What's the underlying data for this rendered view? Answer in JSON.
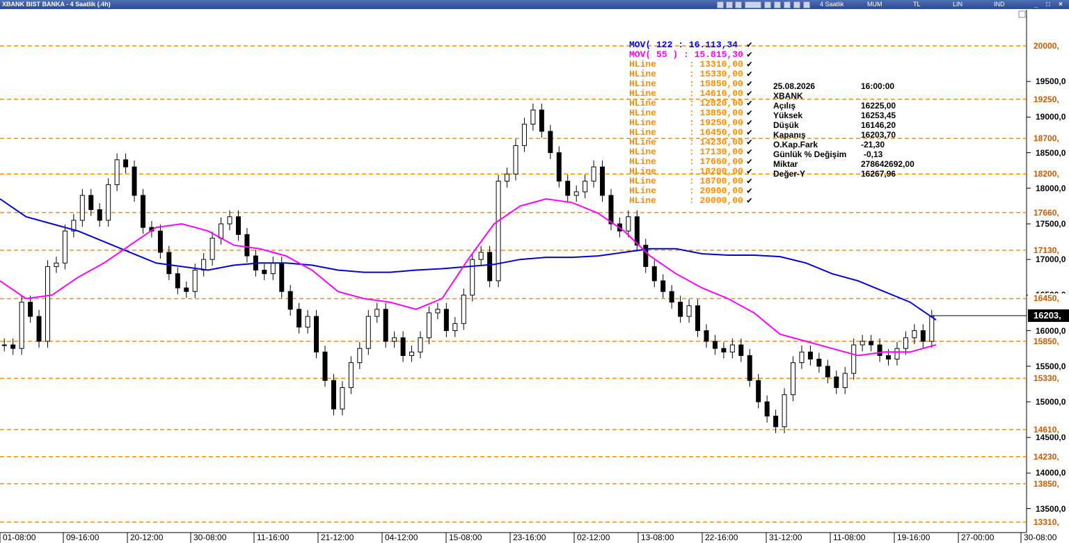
{
  "window": {
    "title": "XBANK BIST BANKA - 4 Saatlik (.4h)",
    "period_label": "4 Saatlik",
    "toolbar_items": [
      "MUM",
      "TL",
      "LIN",
      "IND"
    ],
    "controls": [
      "_",
      "□",
      "×"
    ]
  },
  "legend": {
    "mov122": {
      "label": "MOV( 122 : 16.113,34",
      "color": "#0000ff"
    },
    "mov55": {
      "label": "MOV( 55 ) : 15.815,30",
      "color": "#ff00ff"
    },
    "hlines": [
      {
        "name": "HLine",
        "value": ": 13310,00"
      },
      {
        "name": "HLine",
        "value": ": 15330,00"
      },
      {
        "name": "HLine",
        "value": ": 15850,00"
      },
      {
        "name": "HLine",
        "value": ": 14610,00"
      },
      {
        "name": "HLine",
        "value": ": 12820,00"
      },
      {
        "name": "HLine",
        "value": ": 13850,00"
      },
      {
        "name": "HLine",
        "value": ": 19250,00"
      },
      {
        "name": "HLine",
        "value": ": 16450,00"
      },
      {
        "name": "HLine",
        "value": ": 14230,00"
      },
      {
        "name": "HLine",
        "value": ": 17130,00"
      },
      {
        "name": "HLine",
        "value": ": 17660,00"
      },
      {
        "name": "HLine",
        "value": ": 18200,00"
      },
      {
        "name": "HLine",
        "value": ": 18700,00"
      },
      {
        "name": "HLine",
        "value": ": 20900,00"
      },
      {
        "name": "HLine",
        "value": ": 20000,00"
      }
    ],
    "hline_color": "#ff8c00"
  },
  "info_panel": {
    "date": "25.08.2026",
    "time": "16:00:00",
    "symbol": "XBANK",
    "rows": [
      {
        "label": "Açılış",
        "value": "16225,00"
      },
      {
        "label": "Yüksek",
        "value": "16253,45"
      },
      {
        "label": "Düşük",
        "value": "16146,20"
      },
      {
        "label": "Kapanış",
        "value": "16203,70"
      },
      {
        "label": "O.Kap.Fark",
        "value": "-21,30"
      },
      {
        "label": "Günlük % Değişim",
        "value": "-0,13"
      },
      {
        "label": "Miktar",
        "value": "278642692,00"
      },
      {
        "label": "Değer-Y",
        "value": "16267,96"
      }
    ]
  },
  "chart_data": {
    "type": "candlestick",
    "symbol": "XBANK",
    "ylim": [
      13250,
      20250
    ],
    "y_ticks": [
      13500,
      14000,
      14500,
      15000,
      15500,
      16000,
      16500,
      17000,
      17500,
      18000,
      18500,
      19000,
      19500
    ],
    "y_tick_labels": [
      "13500,0",
      "14000,0",
      "14500,0",
      "15000,0",
      "15500,0",
      "16000,0",
      "16500,0",
      "17000,0",
      "17500,0",
      "18000,0",
      "18500,0",
      "19000,0",
      "19500,0"
    ],
    "x_labels": [
      "01-08:00",
      "09-16:00",
      "20-12:00",
      "30-08:00",
      "11-16:00",
      "21-12:00",
      "04-12:00",
      "15-08:00",
      "23-16:00",
      "02-12:00",
      "13-08:00",
      "22-16:00",
      "31-12:00",
      "11-08:00",
      "19-16:00",
      "27-00:00",
      "30-08:00"
    ],
    "hline_levels": [
      20000,
      19250,
      18700,
      18200,
      17660,
      17130,
      16450,
      15850,
      15330,
      14610,
      14230,
      13850,
      13310
    ],
    "hline_labels": [
      "20000,",
      "19250,",
      "18700,",
      "18200,",
      "17660,",
      "17130,",
      "16450,",
      "15850,",
      "15330,",
      "14610,",
      "14230,",
      "13850,",
      "13310,"
    ],
    "last_price": 16203,
    "last_price_label": "16203,",
    "series_close": [
      15800,
      15750,
      16400,
      16200,
      15850,
      16900,
      16950,
      17400,
      17550,
      17900,
      17700,
      17550,
      18050,
      18400,
      18300,
      17900,
      17450,
      17400,
      17100,
      16800,
      16600,
      16550,
      16850,
      17000,
      17300,
      17500,
      17600,
      17350,
      17050,
      16850,
      16800,
      16950,
      16550,
      16300,
      16050,
      16200,
      15700,
      15300,
      14900,
      15200,
      15550,
      15750,
      16200,
      16300,
      15850,
      15900,
      15650,
      15700,
      15900,
      16250,
      16300,
      16000,
      16100,
      16500,
      17000,
      17100,
      16700,
      18100,
      18200,
      18600,
      18900,
      19100,
      18800,
      18500,
      18100,
      17900,
      17950,
      18100,
      18300,
      17900,
      17500,
      17400,
      17600,
      17200,
      16900,
      16700,
      16550,
      16400,
      16200,
      16350,
      16000,
      15850,
      15750,
      15700,
      15800,
      15650,
      15300,
      15000,
      14800,
      14650,
      15100,
      15550,
      15700,
      15600,
      15500,
      15350,
      15200,
      15400,
      15800,
      15850,
      15800,
      15650,
      15600,
      15750,
      15900,
      16000,
      15850,
      16203
    ],
    "mov122": [
      17850,
      17600,
      17500,
      17400,
      17250,
      17100,
      16950,
      16900,
      16850,
      16920,
      16950,
      16950,
      16920,
      16850,
      16820,
      16820,
      16850,
      16870,
      16900,
      16930,
      17000,
      17030,
      17030,
      17050,
      17100,
      17150,
      17150,
      17080,
      17060,
      17060,
      17040,
      16950,
      16800,
      16700,
      16550,
      16400,
      16150
    ],
    "mov55": [
      16700,
      16450,
      16500,
      16750,
      16950,
      17200,
      17450,
      17500,
      17400,
      17200,
      17150,
      17050,
      16850,
      16550,
      16450,
      16400,
      16300,
      16450,
      17000,
      17500,
      17750,
      17850,
      17800,
      17650,
      17400,
      17050,
      16800,
      16600,
      16450,
      16250,
      15950,
      15850,
      15750,
      15650,
      15700,
      15700,
      15800
    ]
  }
}
